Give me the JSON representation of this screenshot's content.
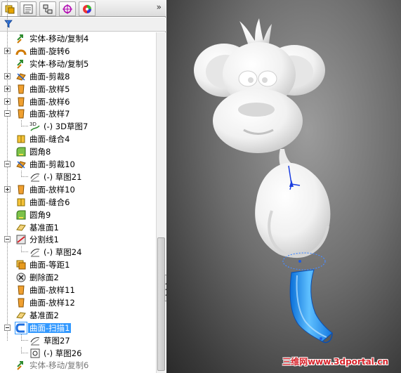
{
  "panel": {
    "tabs": [
      {
        "name": "featuremanager-tab"
      },
      {
        "name": "propertymanager-tab"
      },
      {
        "name": "configurationmanager-tab"
      },
      {
        "name": "dimxpert-tab"
      },
      {
        "name": "display-manager-tab"
      }
    ],
    "expand_glyph": "»",
    "filter_icon": "funnel-icon"
  },
  "tree": [
    {
      "label": "实体-移动/复制4",
      "icon": "move-copy-icon",
      "expand": "none",
      "indent": 0
    },
    {
      "label": "曲面-旋转6",
      "icon": "surface-revolve-icon",
      "expand": "plus",
      "indent": 0
    },
    {
      "label": "实体-移动/复制5",
      "icon": "move-copy-icon",
      "expand": "none",
      "indent": 0
    },
    {
      "label": "曲面-剪裁8",
      "icon": "surface-trim-icon",
      "expand": "plus",
      "indent": 0
    },
    {
      "label": "曲面-放样5",
      "icon": "surface-loft-icon",
      "expand": "plus",
      "indent": 0
    },
    {
      "label": "曲面-放样6",
      "icon": "surface-loft-icon",
      "expand": "plus",
      "indent": 0
    },
    {
      "label": "曲面-放样7",
      "icon": "surface-loft-icon",
      "expand": "minus",
      "indent": 0
    },
    {
      "label": "(-) 3D草图7",
      "icon": "3d-sketch-icon",
      "expand": "none",
      "indent": 1
    },
    {
      "label": "曲面-缝合4",
      "icon": "surface-knit-icon",
      "expand": "none",
      "indent": 0
    },
    {
      "label": "圆角8",
      "icon": "fillet-icon",
      "expand": "none",
      "indent": 0
    },
    {
      "label": "曲面-剪裁10",
      "icon": "surface-trim-icon",
      "expand": "minus",
      "indent": 0
    },
    {
      "label": "(-) 草图21",
      "icon": "sketch-icon",
      "expand": "none",
      "indent": 1
    },
    {
      "label": "曲面-放样10",
      "icon": "surface-loft-icon",
      "expand": "plus",
      "indent": 0
    },
    {
      "label": "曲面-缝合6",
      "icon": "surface-knit-icon",
      "expand": "none",
      "indent": 0
    },
    {
      "label": "圆角9",
      "icon": "fillet-icon",
      "expand": "none",
      "indent": 0
    },
    {
      "label": "基准面1",
      "icon": "plane-icon",
      "expand": "none",
      "indent": 0
    },
    {
      "label": "分割线1",
      "icon": "split-line-icon",
      "expand": "minus",
      "indent": 0
    },
    {
      "label": "(-) 草图24",
      "icon": "sketch-icon",
      "expand": "none",
      "indent": 1
    },
    {
      "label": "曲面-等距1",
      "icon": "surface-offset-icon",
      "expand": "none",
      "indent": 0
    },
    {
      "label": "删除面2",
      "icon": "delete-face-icon",
      "expand": "none",
      "indent": 0
    },
    {
      "label": "曲面-放样11",
      "icon": "surface-loft-icon",
      "expand": "none",
      "indent": 0
    },
    {
      "label": "曲面-放样12",
      "icon": "surface-loft-icon",
      "expand": "none",
      "indent": 0
    },
    {
      "label": "基准面2",
      "icon": "plane-icon",
      "expand": "none",
      "indent": 0
    },
    {
      "label": "曲面-扫描1",
      "icon": "surface-sweep-icon",
      "expand": "minus",
      "indent": 0,
      "selected": true
    },
    {
      "label": "草图27",
      "icon": "sketch-icon",
      "expand": "none",
      "indent": 1
    },
    {
      "label": "(-) 草图26",
      "icon": "sketch-lock-icon",
      "expand": "none",
      "indent": 1
    },
    {
      "label": "实体-移动/复制6",
      "icon": "move-copy-icon",
      "expand": "none",
      "indent": 0,
      "dim": true
    }
  ],
  "viewport": {
    "model": "monkey-surface-model",
    "watermark": "三维网www.3dportal.cn"
  },
  "colors": {
    "selection": "#3399ff",
    "sweep_surface": "#2f9bff",
    "watermark": "#d8232a"
  }
}
